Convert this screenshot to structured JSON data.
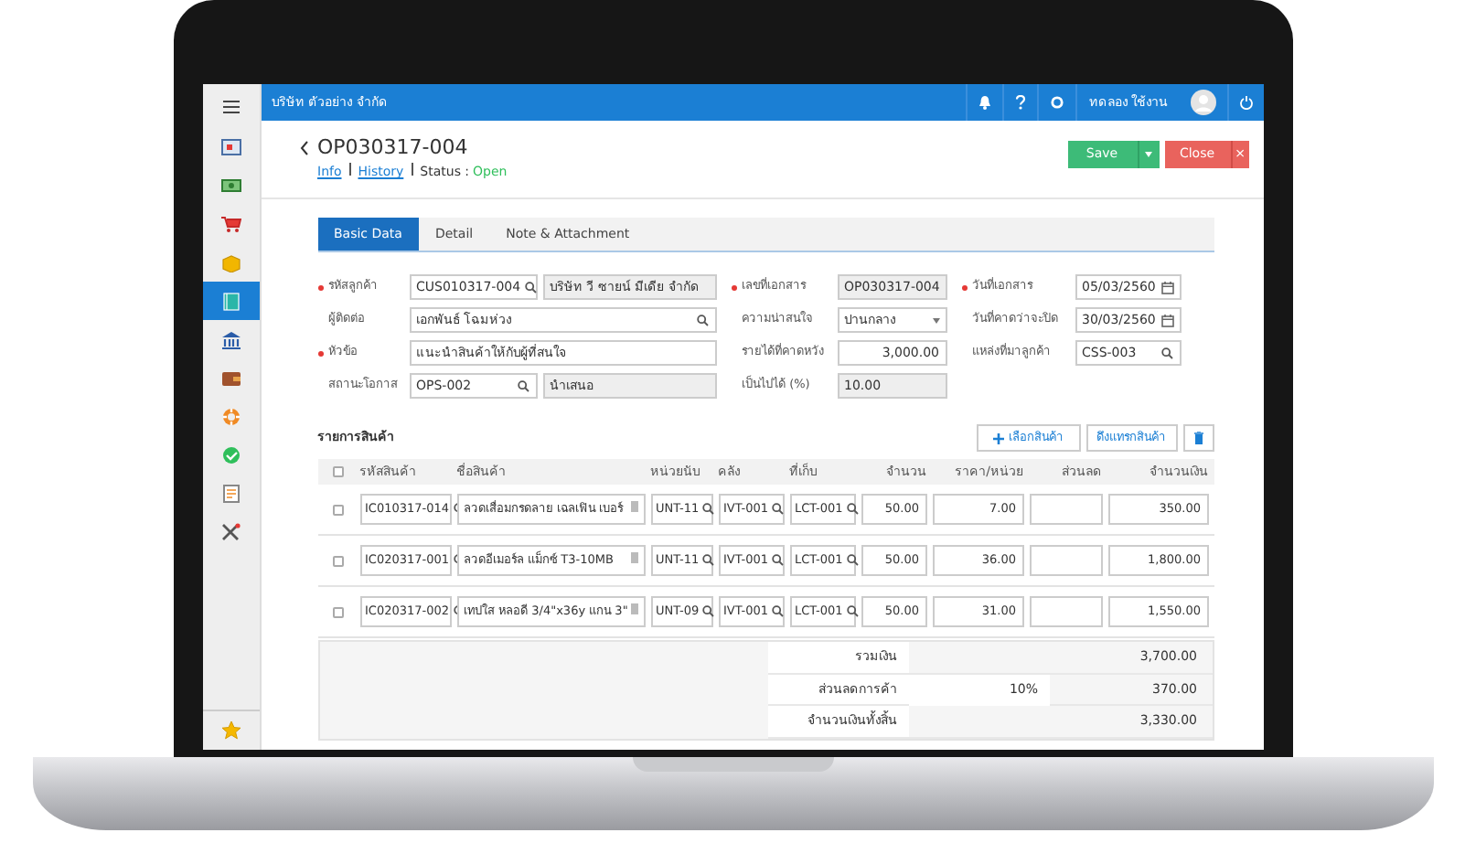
{
  "topbar": {
    "company": "บริษัท ตัวอย่าง จำกัด",
    "user": "ทดลอง ใช้งาน"
  },
  "sidebar": {
    "items": [
      {
        "selected": false
      },
      {
        "selected": false
      },
      {
        "selected": false
      },
      {
        "selected": false
      },
      {
        "selected": true
      },
      {
        "selected": false
      },
      {
        "selected": false
      },
      {
        "selected": false
      },
      {
        "selected": false
      },
      {
        "selected": false
      },
      {
        "selected": false
      }
    ]
  },
  "document": {
    "number": "OP030317-004",
    "links": [
      {
        "label": "Info"
      },
      {
        "label": "History"
      }
    ],
    "status_label": "Status :",
    "status": "Open"
  },
  "actions": {
    "save": "Save",
    "close": "Close",
    "close_x": "×"
  },
  "tabs": [
    {
      "label": "Basic Data",
      "selected": true
    },
    {
      "label": "Detail",
      "selected": false
    },
    {
      "label": "Note & Attachment",
      "selected": false
    }
  ],
  "form": {
    "columns": [
      [
        {
          "label": "รหัสลูกค้า",
          "required": true,
          "kind": "lookup",
          "value": "CUS010317-004",
          "companion": "บริษัท วี ซายน์ มีเดีย จำกัด"
        },
        {
          "label": "ผู้ติดต่อ",
          "required": false,
          "kind": "lookup",
          "value": "เอกพันธ์ โฉมห่วง"
        },
        {
          "label": "หัวข้อ",
          "required": true,
          "kind": "text",
          "value": "แนะนำสินค้าให้กับผู้ที่สนใจ"
        },
        {
          "label": "สถานะโอกาส",
          "required": false,
          "kind": "lookup",
          "value": "OPS-002",
          "companion": "นำเสนอ"
        }
      ],
      [
        {
          "label": "เลขที่เอกสาร",
          "required": true,
          "kind": "readonly",
          "value": "OP030317-004"
        },
        {
          "label": "ความน่าสนใจ",
          "required": false,
          "kind": "select",
          "value": "ปานกลาง"
        },
        {
          "label": "รายได้ที่คาดหวัง",
          "required": false,
          "kind": "number",
          "value": "3,000.00"
        },
        {
          "label": "เป็นไปได้ (%)",
          "required": false,
          "kind": "readonly",
          "value": "10.00"
        }
      ],
      [
        {
          "label": "วันที่เอกสาร",
          "required": true,
          "kind": "date",
          "value": "05/03/2560"
        },
        {
          "label": "วันที่คาดว่าจะปิด",
          "required": false,
          "kind": "date",
          "value": "30/03/2560"
        },
        {
          "label": "แหล่งที่มาลูกค้า",
          "required": false,
          "kind": "lookup",
          "value": "CSS-003"
        }
      ]
    ]
  },
  "items": {
    "title": "รายการสินค้า",
    "buttons": [
      "เลือกสินค้า",
      "ดึงแทรกสินค้า"
    ],
    "columns": [
      "รหัสสินค้า",
      "ชื่อสินค้า",
      "หน่วยนับ",
      "คลัง",
      "ที่เก็บ",
      "จำนวน",
      "ราคา/หน่วย",
      "ส่วนลด",
      "จำนวนเงิน"
    ],
    "header_checked": false,
    "rows": [
      {
        "checked": false,
        "code": "IC010317-014",
        "name": "ลวดเสื่อมกรดลาย เฉลเฟิน เบอร์",
        "unit": "UNT-11",
        "warehouse": "IVT-001",
        "location": "LCT-001",
        "qty": "50.00",
        "price": "7.00",
        "amount": "350.00"
      },
      {
        "checked": false,
        "code": "IC020317-001",
        "name": "ลวดอีเมอร์ล แม็กซ์ T3-10MB",
        "unit": "UNT-11",
        "warehouse": "IVT-001",
        "location": "LCT-001",
        "qty": "50.00",
        "price": "36.00",
        "amount": "1,800.00"
      },
      {
        "checked": false,
        "code": "IC020317-002",
        "name": "เทปใส หลอดี 3/4\"x36y แกน 3\"",
        "unit": "UNT-09",
        "warehouse": "IVT-001",
        "location": "LCT-001",
        "qty": "50.00",
        "price": "31.00",
        "amount": "1,550.00"
      }
    ],
    "totals": [
      {
        "label": "รวมเงิน",
        "value": "3,700.00"
      },
      {
        "label": "ส่วนลดการค้า",
        "rate": "10%",
        "value": "370.00"
      },
      {
        "label": "จำนวนเงินทั้งสิ้น",
        "value": "3,330.00"
      }
    ]
  }
}
